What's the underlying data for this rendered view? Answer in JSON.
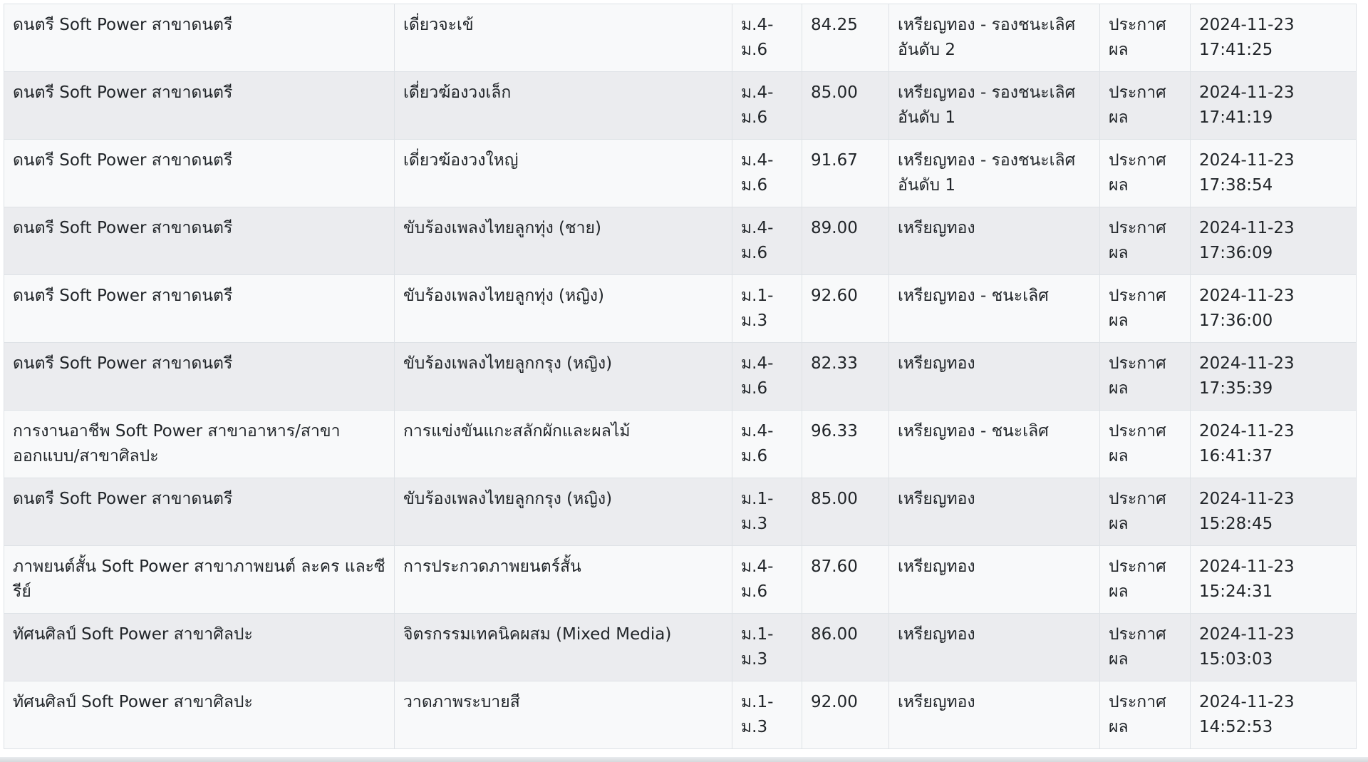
{
  "results_table": {
    "rows": [
      {
        "category": "ดนตรี Soft Power สาขาดนตรี",
        "event": "เดี่ยวจะเข้",
        "level": "ม.4-ม.6",
        "score": "84.25",
        "award": "เหรียญทอง - รองชนะเลิศอันดับ 2",
        "status": "ประกาศผล",
        "timestamp": "2024-11-23 17:41:25"
      },
      {
        "category": "ดนตรี Soft Power สาขาดนตรี",
        "event": "เดี่ยวฆ้องวงเล็ก",
        "level": "ม.4-ม.6",
        "score": "85.00",
        "award": "เหรียญทอง - รองชนะเลิศอันดับ 1",
        "status": "ประกาศผล",
        "timestamp": "2024-11-23 17:41:19"
      },
      {
        "category": "ดนตรี Soft Power สาขาดนตรี",
        "event": "เดี่ยวฆ้องวงใหญ่",
        "level": "ม.4-ม.6",
        "score": "91.67",
        "award": "เหรียญทอง - รองชนะเลิศอันดับ 1",
        "status": "ประกาศผล",
        "timestamp": "2024-11-23 17:38:54"
      },
      {
        "category": "ดนตรี Soft Power สาขาดนตรี",
        "event": "ขับร้องเพลงไทยลูกทุ่ง (ชาย)",
        "level": "ม.4-ม.6",
        "score": "89.00",
        "award": "เหรียญทอง",
        "status": "ประกาศผล",
        "timestamp": "2024-11-23 17:36:09"
      },
      {
        "category": "ดนตรี Soft Power สาขาดนตรี",
        "event": "ขับร้องเพลงไทยลูกทุ่ง (หญิง)",
        "level": "ม.1-ม.3",
        "score": "92.60",
        "award": "เหรียญทอง - ชนะเลิศ",
        "status": "ประกาศผล",
        "timestamp": "2024-11-23 17:36:00"
      },
      {
        "category": "ดนตรี Soft Power สาขาดนตรี",
        "event": "ขับร้องเพลงไทยลูกกรุง (หญิง)",
        "level": "ม.4-ม.6",
        "score": "82.33",
        "award": "เหรียญทอง",
        "status": "ประกาศผล",
        "timestamp": "2024-11-23 17:35:39"
      },
      {
        "category": "การงานอาชีพ Soft Power สาขาอาหาร/สาขาออกแบบ/สาขาศิลปะ",
        "event": "การแข่งขันแกะสลักผักและผลไม้",
        "level": "ม.4-ม.6",
        "score": "96.33",
        "award": "เหรียญทอง - ชนะเลิศ",
        "status": "ประกาศผล",
        "timestamp": "2024-11-23 16:41:37"
      },
      {
        "category": "ดนตรี Soft Power สาขาดนตรี",
        "event": "ขับร้องเพลงไทยลูกกรุง (หญิง)",
        "level": "ม.1-ม.3",
        "score": "85.00",
        "award": "เหรียญทอง",
        "status": "ประกาศผล",
        "timestamp": "2024-11-23 15:28:45"
      },
      {
        "category": "ภาพยนต์สั้น Soft Power สาขาภาพยนต์ ละคร และซีรีย์",
        "event": "การประกวดภาพยนตร์สั้น",
        "level": "ม.4-ม.6",
        "score": "87.60",
        "award": "เหรียญทอง",
        "status": "ประกาศผล",
        "timestamp": "2024-11-23 15:24:31"
      },
      {
        "category": "ทัศนศิลป์ Soft Power สาขาศิลปะ",
        "event": "จิตรกรรมเทคนิคผสม (Mixed Media)",
        "level": "ม.1-ม.3",
        "score": "86.00",
        "award": "เหรียญทอง",
        "status": "ประกาศผล",
        "timestamp": "2024-11-23 15:03:03"
      },
      {
        "category": "ทัศนศิลป์ Soft Power สาขาศิลปะ",
        "event": "วาดภาพระบายสี",
        "level": "ม.1-ม.3",
        "score": "92.00",
        "award": "เหรียญทอง",
        "status": "ประกาศผล",
        "timestamp": "2024-11-23 14:52:53"
      }
    ]
  }
}
